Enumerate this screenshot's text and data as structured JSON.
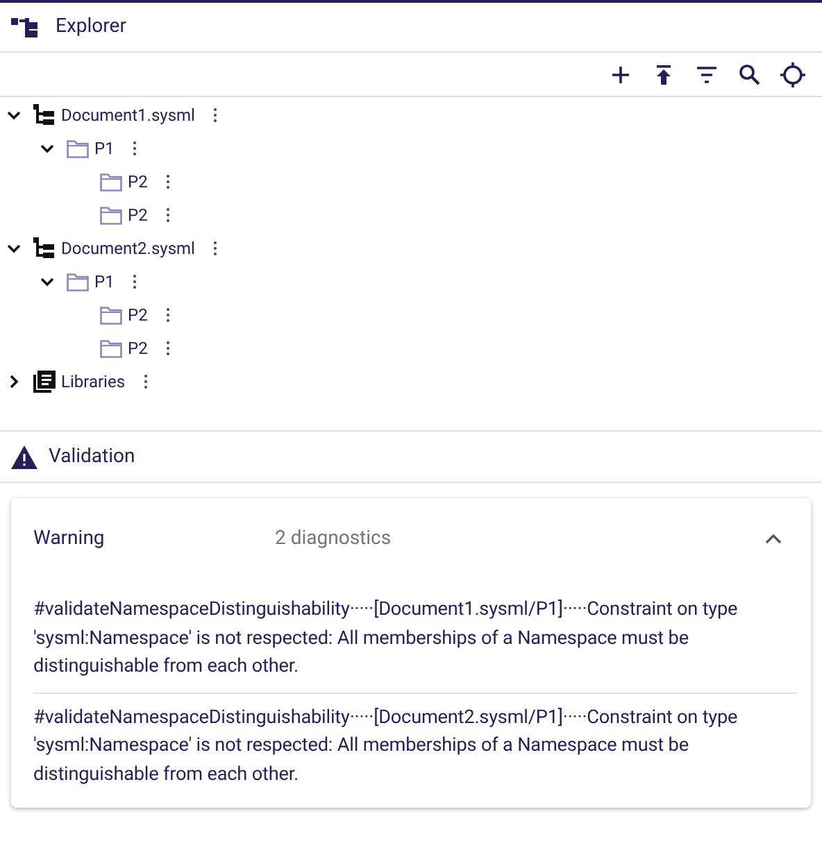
{
  "explorer": {
    "title": "Explorer",
    "toolbar": [
      {
        "kind": "add"
      },
      {
        "kind": "upload"
      },
      {
        "kind": "filter"
      },
      {
        "kind": "search"
      },
      {
        "kind": "locate"
      }
    ],
    "tree": [
      {
        "label": "Document1.sysml",
        "kind": "document",
        "expanded": true,
        "children": [
          {
            "label": "P1",
            "kind": "folder",
            "expanded": true,
            "children": [
              {
                "label": "P2",
                "kind": "folder"
              },
              {
                "label": "P2",
                "kind": "folder"
              }
            ]
          }
        ]
      },
      {
        "label": "Document2.sysml",
        "kind": "document",
        "expanded": true,
        "children": [
          {
            "label": "P1",
            "kind": "folder",
            "expanded": true,
            "children": [
              {
                "label": "P2",
                "kind": "folder"
              },
              {
                "label": "P2",
                "kind": "folder"
              }
            ]
          }
        ]
      },
      {
        "label": "Libraries",
        "kind": "library",
        "expanded": false
      }
    ]
  },
  "validation": {
    "title": "Validation",
    "groups": [
      {
        "severity": "Warning",
        "count": "2 diagnostics",
        "expanded": true,
        "messages": [
          "#validateNamespaceDistinguishability·····[Document1.sysml/P1]·····Constraint on type 'sysml:Namespace' is not respected: All memberships of a Namespace must be distinguishable from each other.",
          "#validateNamespaceDistinguishability·····[Document2.sysml/P1]·····Constraint on type 'sysml:Namespace' is not respected: All memberships of a Namespace must be distinguishable from each other."
        ]
      }
    ]
  }
}
